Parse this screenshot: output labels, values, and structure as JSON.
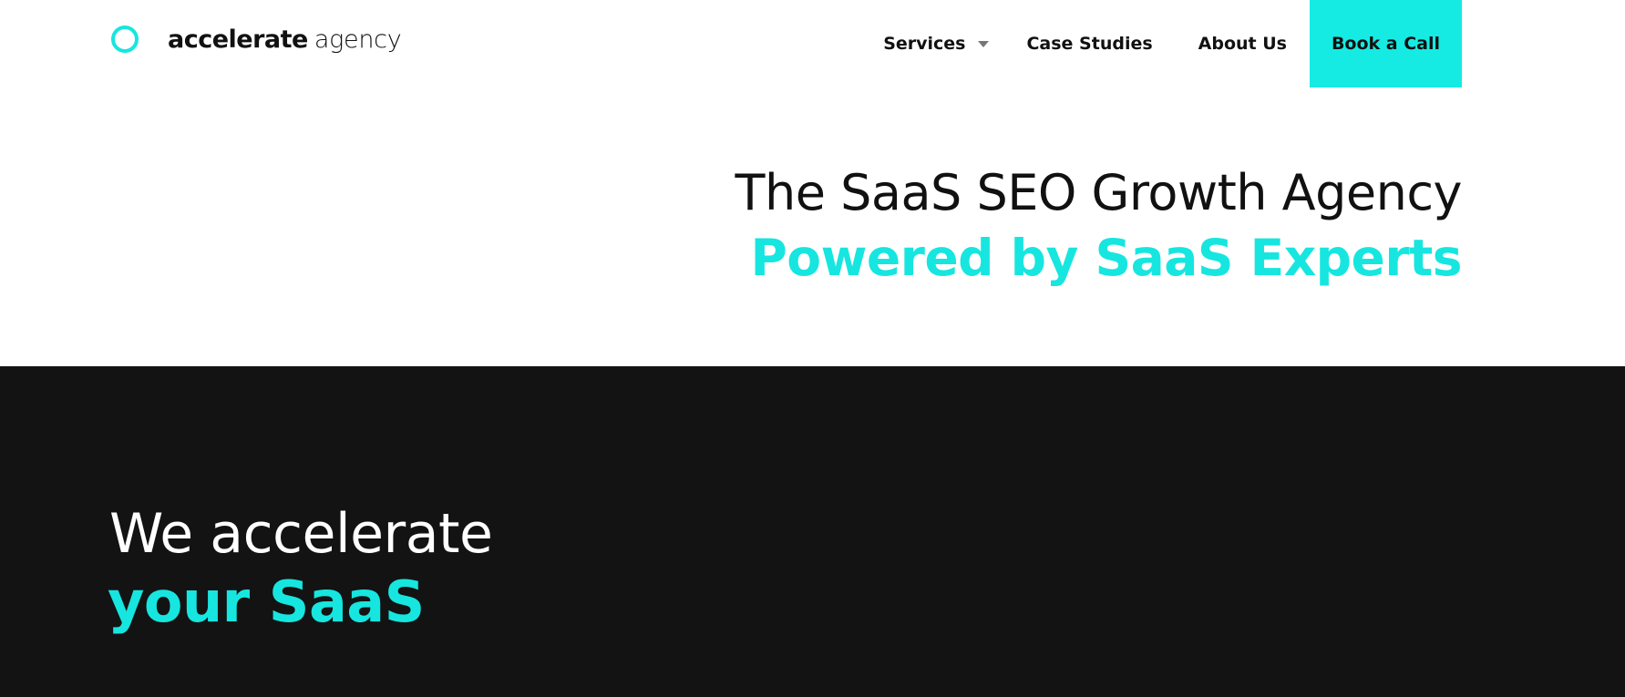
{
  "header": {
    "logo": {
      "bold": "accelerate",
      "light": "agency",
      "icon": "ring-icon"
    },
    "nav": {
      "services_label": "Services",
      "case_studies_label": "Case Studies",
      "about_label": "About Us",
      "cta_label": "Book a Call"
    }
  },
  "hero": {
    "line1": "The SaaS SEO Growth Agency",
    "line2": "Powered by SaaS Experts"
  },
  "section": {
    "line1": "We accelerate",
    "line2": "your SaaS"
  },
  "colors": {
    "accent": "#16e6df",
    "dark_bg": "#131313",
    "text": "#111111"
  }
}
